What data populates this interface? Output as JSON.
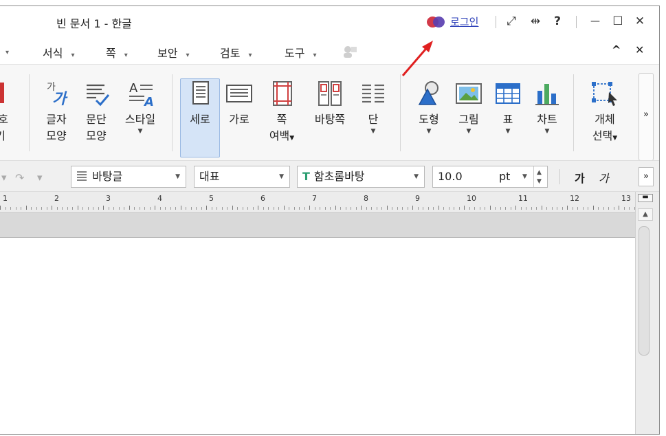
{
  "window": {
    "title": "빈 문서 1 - 한글",
    "login_label": "로그인"
  },
  "title_icons": [
    "fullscreen-icon",
    "resize-icon",
    "help-icon",
    "minimize-icon",
    "maximize-icon",
    "close-icon"
  ],
  "title_icon_glyphs": {
    "fullscreen": "⤢",
    "resize": "⇹",
    "help": "?",
    "minimize": "—",
    "maximize": "☐",
    "close": "✕"
  },
  "menu": {
    "items": [
      "서식",
      "쪽",
      "보안",
      "검토",
      "도구"
    ],
    "dropdown_glyph": "▾",
    "collapse_glyph": "^",
    "close_glyph": "✕"
  },
  "ribbon": {
    "partial_left": {
      "line1": "호",
      "line2": "기"
    },
    "char_shape": {
      "line1": "글자",
      "line2": "모양"
    },
    "para_shape": {
      "line1": "문단",
      "line2": "모양"
    },
    "style": {
      "line1": "스타일"
    },
    "vertical": {
      "line1": "세로"
    },
    "horizontal": {
      "line1": "가로"
    },
    "page_margin": {
      "line1": "쪽",
      "line2": "여백"
    },
    "background_page": {
      "line1": "바탕쪽"
    },
    "column": {
      "line1": "단"
    },
    "shape": {
      "line1": "도형"
    },
    "picture": {
      "line1": "그림"
    },
    "table": {
      "line1": "표"
    },
    "chart": {
      "line1": "차트"
    },
    "select_object": {
      "line1": "개체",
      "line2": "선택"
    },
    "more_glyph": "»",
    "char_icon_small": "가",
    "char_icon_big": "가",
    "style_icon_letter": "A"
  },
  "format_bar": {
    "style_value": "바탕글",
    "language_value": "대표",
    "font_value": "함초롬바탕",
    "font_icon_glyph": "T",
    "size_value": "10.0",
    "size_unit": "pt",
    "bold_char": "가",
    "italic_char": "가",
    "more_glyph": "»"
  },
  "ruler": {
    "numbers": [
      "1",
      "2",
      "3",
      "4",
      "5",
      "6",
      "7",
      "8",
      "9",
      "10",
      "11",
      "12",
      "13"
    ]
  },
  "colors": {
    "login_link": "#2a3db8",
    "accent_blue": "#2c6fc9",
    "selected_bg": "#d5e4f7",
    "annotation_arrow": "#e02020"
  }
}
